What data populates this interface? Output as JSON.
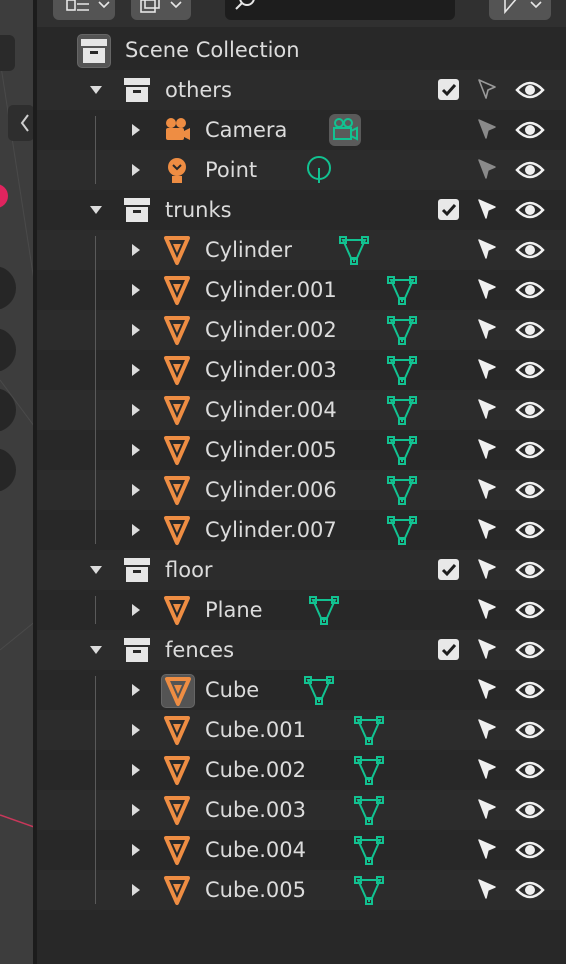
{
  "colors": {
    "panel_bg": "#282828",
    "row_alt": "#2c2c2c",
    "mesh_orange": "#ee8d43",
    "data_green": "#12c291",
    "text": "#dcdcdc"
  },
  "header": {
    "display_mode_icon": "outliner-icon",
    "filter_icon": "filter-icon",
    "search_placeholder": "",
    "search_icon": "search-icon"
  },
  "outliner": {
    "scene_collection": {
      "label": "Scene Collection"
    },
    "collections": [
      {
        "label": "others",
        "checked": true,
        "objects": [
          {
            "label": "Camera",
            "type": "camera",
            "data_icon": "camera-data-icon"
          },
          {
            "label": "Point",
            "type": "light",
            "data_icon": "light-data-icon"
          }
        ]
      },
      {
        "label": "trunks",
        "checked": true,
        "objects": [
          {
            "label": "Cylinder",
            "type": "mesh",
            "data_icon": "mesh-data-icon"
          },
          {
            "label": "Cylinder.001",
            "type": "mesh",
            "data_icon": "mesh-data-icon"
          },
          {
            "label": "Cylinder.002",
            "type": "mesh",
            "data_icon": "mesh-data-icon"
          },
          {
            "label": "Cylinder.003",
            "type": "mesh",
            "data_icon": "mesh-data-icon"
          },
          {
            "label": "Cylinder.004",
            "type": "mesh",
            "data_icon": "mesh-data-icon"
          },
          {
            "label": "Cylinder.005",
            "type": "mesh",
            "data_icon": "mesh-data-icon"
          },
          {
            "label": "Cylinder.006",
            "type": "mesh",
            "data_icon": "mesh-data-icon"
          },
          {
            "label": "Cylinder.007",
            "type": "mesh",
            "data_icon": "mesh-data-icon"
          }
        ]
      },
      {
        "label": "floor",
        "checked": true,
        "objects": [
          {
            "label": "Plane",
            "type": "mesh",
            "data_icon": "mesh-data-icon"
          }
        ]
      },
      {
        "label": "fences",
        "checked": true,
        "objects": [
          {
            "label": "Cube",
            "type": "mesh",
            "data_icon": "mesh-data-icon",
            "active": true
          },
          {
            "label": "Cube.001",
            "type": "mesh",
            "data_icon": "mesh-data-icon"
          },
          {
            "label": "Cube.002",
            "type": "mesh",
            "data_icon": "mesh-data-icon"
          },
          {
            "label": "Cube.003",
            "type": "mesh",
            "data_icon": "mesh-data-icon"
          },
          {
            "label": "Cube.004",
            "type": "mesh",
            "data_icon": "mesh-data-icon"
          },
          {
            "label": "Cube.005",
            "type": "mesh",
            "data_icon": "mesh-data-icon"
          }
        ]
      }
    ]
  }
}
